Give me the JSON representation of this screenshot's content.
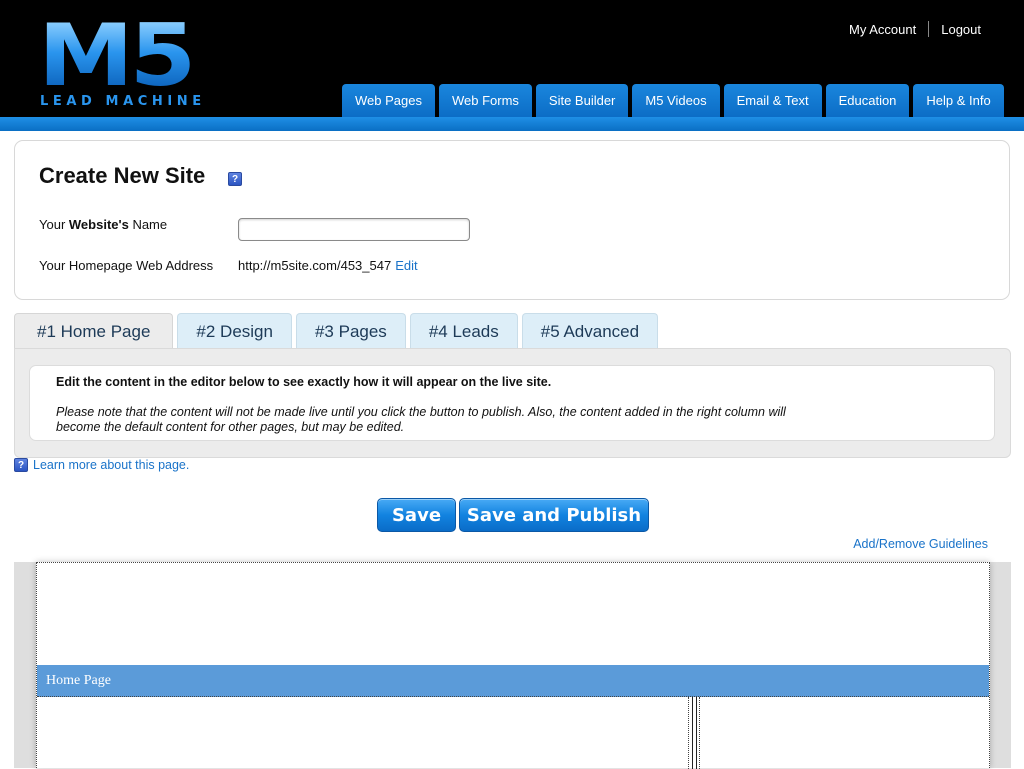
{
  "header": {
    "logo": {
      "mark": "M5",
      "tagline": "LEAD MACHINE"
    },
    "account_links": [
      {
        "label": "My Account"
      },
      {
        "label": "Logout"
      }
    ],
    "nav_tabs": [
      {
        "label": "Web Pages"
      },
      {
        "label": "Web Forms"
      },
      {
        "label": "Site Builder"
      },
      {
        "label": "M5 Videos"
      },
      {
        "label": "Email & Text"
      },
      {
        "label": "Education"
      },
      {
        "label": "Help & Info"
      }
    ]
  },
  "create_site": {
    "title": "Create New Site",
    "help_glyph": "?",
    "name_label_prefix": "Your ",
    "name_label_bold": "Website's",
    "name_label_suffix": " Name",
    "name_value": "",
    "address_label": "Your Homepage Web Address",
    "address_value": "http://m5site.com/453_547",
    "edit_label": "Edit"
  },
  "step_tabs": [
    {
      "label": "#1 Home Page",
      "active": true
    },
    {
      "label": "#2 Design",
      "active": false
    },
    {
      "label": "#3 Pages",
      "active": false
    },
    {
      "label": "#4 Leads",
      "active": false
    },
    {
      "label": "#5 Advanced",
      "active": false
    }
  ],
  "info": {
    "heading": "Edit the content in the editor below to see exactly how it will appear on the live site.",
    "note": "Please note that the content will not be made live until you click the button to publish. Also, the content added in the right column will become the default content for other pages, but may be edited."
  },
  "learn_more": {
    "label": "Learn more about this page.",
    "help_glyph": "?"
  },
  "buttons": {
    "save": "Save",
    "save_publish": "Save and Publish"
  },
  "guidelines_link": "Add/Remove Guidelines",
  "editor": {
    "nav_label": "Home Page"
  },
  "colors": {
    "brand_blue": "#1283e0",
    "header_black": "#000000",
    "link_blue": "#1a73c9",
    "editor_nav_blue": "#5b9bd9"
  }
}
